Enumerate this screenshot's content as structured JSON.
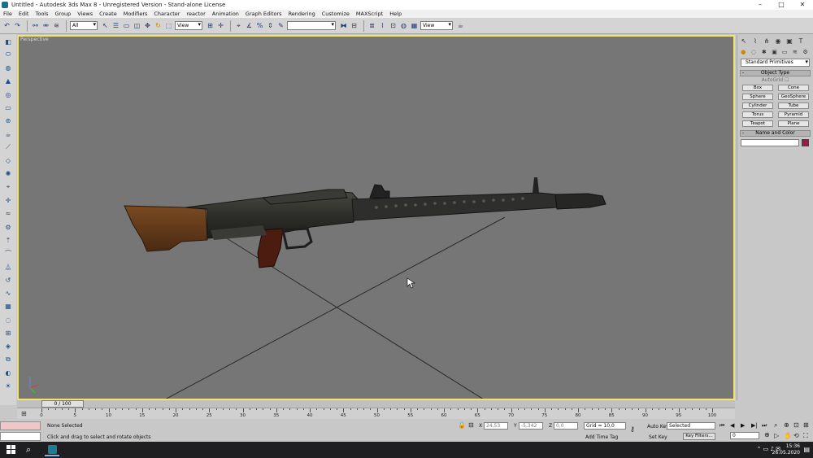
{
  "window": {
    "title": "Untitled - Autodesk 3ds Max 8 - Unregistered Version - Stand-alone License",
    "controls": [
      "–",
      "□",
      "✕"
    ]
  },
  "menu": [
    "File",
    "Edit",
    "Tools",
    "Group",
    "Views",
    "Create",
    "Modifiers",
    "Character",
    "reactor",
    "Animation",
    "Graph Editors",
    "Rendering",
    "Customize",
    "MAXScript",
    "Help"
  ],
  "toolbar": {
    "selection_filter": "All",
    "ref_coord": "View",
    "named_selection": "",
    "render_view": "View"
  },
  "viewport": {
    "label": "Perspective",
    "border_color": "#f2e36a",
    "background": "#767676"
  },
  "command_panel": {
    "category": "Standard Primitives",
    "object_type_title": "Object Type",
    "autogrid_label": "AutoGrid",
    "object_buttons": [
      "Box",
      "Cone",
      "Sphere",
      "GeoSphere",
      "Cylinder",
      "Tube",
      "Torus",
      "Pyramid",
      "Teapot",
      "Plane"
    ],
    "name_color_title": "Name and Color",
    "swatch_color": "#9c1b45"
  },
  "timeline": {
    "slider_label": "0 / 100",
    "ticks": [
      "0",
      "5",
      "10",
      "15",
      "20",
      "25",
      "30",
      "35",
      "40",
      "45",
      "50",
      "55",
      "60",
      "65",
      "70",
      "75",
      "80",
      "85",
      "90",
      "95",
      "100"
    ]
  },
  "status": {
    "selection": "None Selected",
    "prompt": "Click and drag to select and rotate objects",
    "x_label": "X",
    "x_value": "24,53",
    "y_label": "Y",
    "y_value": "-5,342",
    "z_label": "Z",
    "z_value": "0,0",
    "grid": "Grid = 10,0",
    "add_time_tag": "Add Time Tag",
    "auto_key": "Auto Key",
    "set_key": "Set Key",
    "key_mode": "Selected",
    "key_filters": "Key Filters...",
    "frame": "0"
  },
  "taskbar": {
    "time": "15:36",
    "date": "26.05.2020"
  }
}
